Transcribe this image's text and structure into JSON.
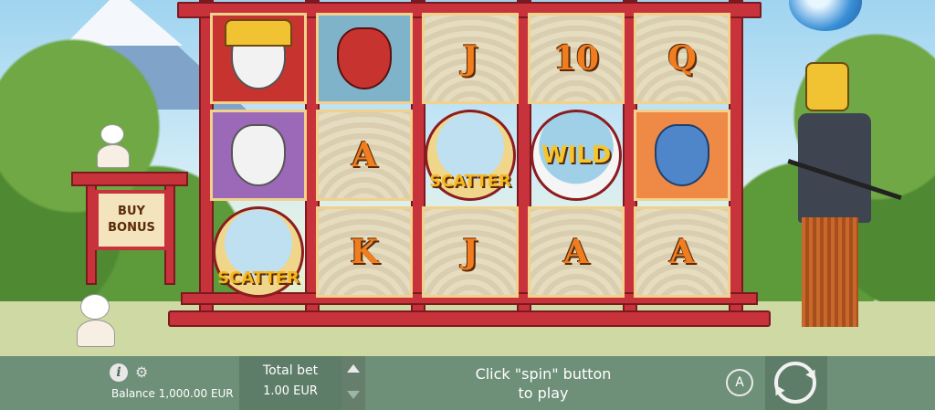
{
  "reels": [
    [
      {
        "kind": "samurai-mask-red"
      },
      {
        "kind": "geisha-mask-purple"
      },
      {
        "kind": "scatter",
        "label": "SCATTER"
      }
    ],
    [
      {
        "kind": "red-demon-blue"
      },
      {
        "kind": "letter",
        "label": "A"
      },
      {
        "kind": "letter",
        "label": "K"
      }
    ],
    [
      {
        "kind": "letter",
        "label": "J"
      },
      {
        "kind": "scatter",
        "label": "SCATTER"
      },
      {
        "kind": "letter",
        "label": "J"
      }
    ],
    [
      {
        "kind": "letter",
        "label": "10"
      },
      {
        "kind": "wild",
        "label": "WILD"
      },
      {
        "kind": "letter",
        "label": "A"
      }
    ],
    [
      {
        "kind": "letter",
        "label": "Q"
      },
      {
        "kind": "blue-samurai-orange"
      },
      {
        "kind": "letter",
        "label": "A"
      }
    ]
  ],
  "buy_bonus": {
    "line1": "BUY",
    "line2": "BONUS"
  },
  "bottom_bar": {
    "info_icon": "i",
    "balance_label": "Balance",
    "balance_value": "1,000.00 EUR",
    "total_bet_label": "Total bet",
    "total_bet_value": "1.00 EUR",
    "message_line1": "Click \"spin\" button",
    "message_line2": "to play",
    "autoplay_label": "A"
  },
  "colors": {
    "frame": "#c8323b",
    "bar": "#6e8f78",
    "letter": "#f07d1e"
  }
}
